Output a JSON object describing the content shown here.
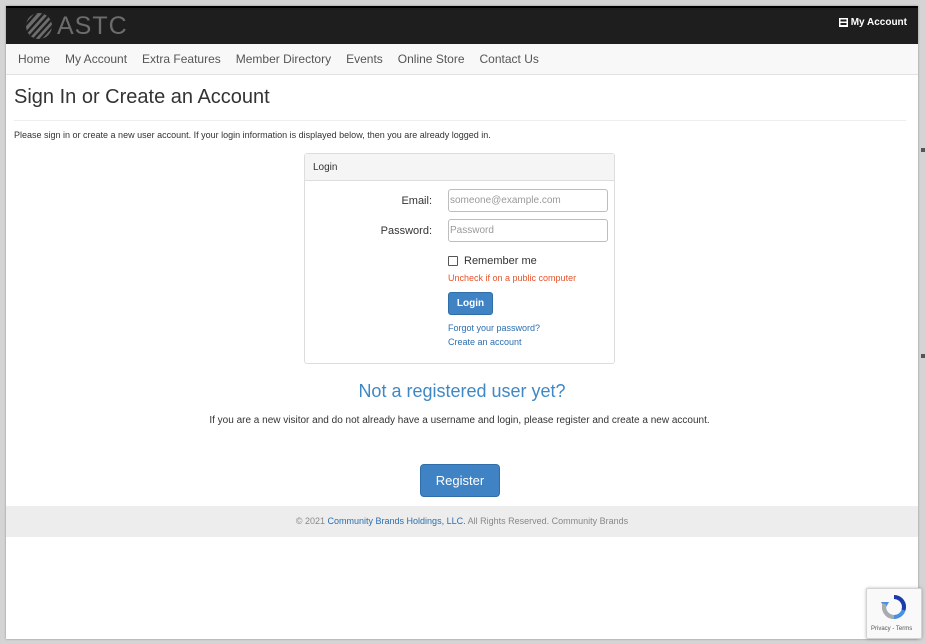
{
  "header": {
    "logo_text": "ASTC",
    "account_link": "My Account",
    "colors": {
      "bar": "#1e1e1e",
      "logo": "#6c6c6c"
    }
  },
  "nav": {
    "items": [
      {
        "label": "Home"
      },
      {
        "label": "My Account"
      },
      {
        "label": "Extra Features"
      },
      {
        "label": "Member Directory"
      },
      {
        "label": "Events"
      },
      {
        "label": "Online Store"
      },
      {
        "label": "Contact Us"
      }
    ]
  },
  "page": {
    "title": "Sign In or Create an Account",
    "intro": "Please sign in or create a new user account. If your login information is displayed below, then you are already logged in."
  },
  "login": {
    "panel_title": "Login",
    "email_label": "Email:",
    "email_placeholder": "someone@example.com",
    "email_value": "",
    "password_label": "Password:",
    "password_placeholder": "Password",
    "password_value": "",
    "remember_label": "Remember me",
    "remember_checked": false,
    "remember_hint": "Uncheck if on a public computer",
    "login_button": "Login",
    "forgot_link": "Forgot your password?",
    "create_link": "Create an account"
  },
  "register": {
    "title": "Not a registered user yet?",
    "text": "If you are a new visitor and do not already have a username and login, please register and create a new account.",
    "button": "Register"
  },
  "footer": {
    "copyright": "© 2021",
    "company_link": "Community Brands Holdings, LLC.",
    "rights": "All Rights Reserved. Community Brands"
  },
  "recaptcha": {
    "terms": "Privacy - Terms"
  },
  "theme": {
    "primary": "#3f83c4",
    "link": "#2a6fb0",
    "heading_blue": "#3f88c5",
    "hint_red": "#e8532a"
  }
}
